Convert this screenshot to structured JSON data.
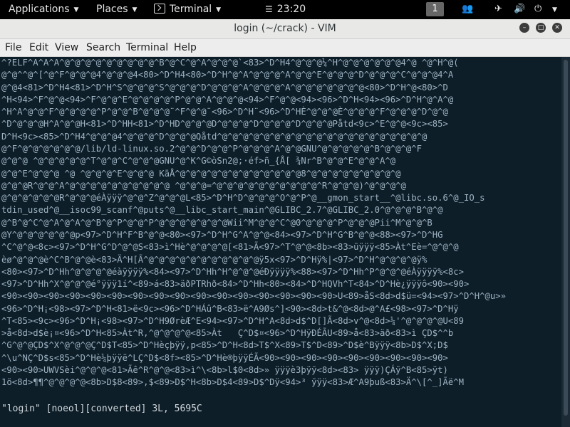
{
  "topbar": {
    "applications": "Applications",
    "places": "Places",
    "terminal": "Terminal",
    "clock": "23:20",
    "workspace": "1"
  },
  "window": {
    "title": "login (~/crack) - VIM"
  },
  "menu": [
    "File",
    "Edit",
    "View",
    "Search",
    "Terminal",
    "Help"
  ],
  "terminal": {
    "lines": [
      "^?ELF^A^A^A^@^@^@^@^@^@^@^@^@^B^@^C^@^A^@^@^@`<83>^D^H4^@^@^@¼^H^@^@^@^@^@^@4^@ ^@^H^@(",
      "@^@^^@^[^@^F^@^@^@4^@^@^@4<80>^D^H4<80>^D^H^@^A^@^@^@^A^@^@^E^@^@^@^D^@^@^@^C^@^@^@4^A",
      "@^@4<81>^D^H4<81>^D^H^S^@^@^@^S^@^@^@^D^@^@^@^A^@^@^@^A^@^@^@^@^@^@^@<80>^D^H^@<80>^D",
      "^H<94>^F^@^@<94>^F^@^@^E^@^@^@^@^P^@^@^A^@^@^@<94>^F^@^@<94><96>^D^H<94><96>^D^H^@^A^@",
      "^H^A^@^@^F^@^@^@^@^P^@^@^B^@^@^@¨^F^@^@¨<96>^D^H¨<96>^D^HÈ^@^@^@È^@^@^@^F^@^@^@^D^@^@",
      "^D^@^@^@H^A^@^@H<81>^D^HH<81>^D^HD^@^@^@D^@^@^@^D^@^@^@^D^@^@^@Påtd<9c>^E^@^@<9c><85>",
      "D^H<9c><85>^D^H4^@^@^@4^@^@^@^D^@^@^@Qåtd^@^@^@^@^@^@^@^@^@^@^@^@^@^@^@^@^@^@^@^@",
      "@^F^@^@^@^@^@^@/lib/ld-linux.so.2^@^@^D^@^@^P^@^@^@^A^@^@GNU^@^@^@^@^@^B^@^@^@^F",
      "@^@^@ ^@^@^@^@^@^T^@^@^C^@^@^@GNU^@^K^G©òSn2@;·éf>ñ_{Å[ ¾Nr^B^@^@^E^@^@^A^@",
      "@^@^E^@^@^@ ^@ ^@^@^@^E^@^@^@ KäÅ^@^@^@^@^@^@^@^@^@^@^@^@8^@^@^@^@^@^@^@^@^@",
      "@^@^@R^@^@^A^@^@^@^@^@^@^@^@^@^@ ^@^@^@=^@^@^@^@^@^@^@^@^@^@^R^@^@^@)^@^@^@^@",
      "@^@^@^@^@^@R^@^@^@éÀÿÿÿ^@^@^Z^@^@^@L<85>^D^H^D^@^@^@^O^@^P^@__gmon_start__^@libc.so.6^@_IO_s",
      "tdin_used^@__isoc99_scanf^@puts^@__libc_start_main^@GLIBC_2.7^@GLIBC_2.0^@^@^@^B^@^@",
      "@^B^@^C^@^A^@^A^@^B^@^P^@^@^P^@^@^@^@^@^@^@Wii^M^@^@^C^@0^@^@^@^P^@^@^@Pii^M^@^@^B",
      "@Y^@^@^@^@^@^@p<97>^D^H^F^B^@^@<80><97>^D^H^G^A^@^@<84><97>^D^H^G^B^@^@<88><97>^D^HG",
      "^C^@^@<8c><97>^D^H^G^D^@^@S<83>ì^Hè^@^@^@^@[<81>Ã<97>^T^@^@<8b><83>üÿÿÿ<85>Àt^Eè=^@^@^@",
      "èø^@^@^@è^C^B^@^@è<83>Ä^H[Ã^@^@^@^@^@^@^@^@^@^@^@ÿ5x<97>^D^Hÿ%|<97>^D^H^@^@^@^@ÿ%",
      "<80><97>^D^Hh^@^@^@^@éàÿÿÿÿ%<84><97>^D^Hh^H^@^@^@éÐÿÿÿÿ%<88><97>^D^Hh^P^@^@^@éÀÿÿÿÿ%<8c>",
      "<97>^D^Hh^X^@^@^@é°ÿÿÿ1í^<89>á<83>äðPTRhð<84>^D^Hh<80><84>^D^HQVh^T<84>^D^Hè¿ÿÿÿô<90><90>",
      "<90><90><90><90><90><90><90><90><90><90><90><90><90><90><90><90>U<89>åS<8d>d$ü=<94><97>^D^H^@u>»",
      "<96>^D^H¡<98><97>^D^H<81>ë<9c><96>^D^HÁû^B<83>ë^A9Øs^]<90><8d>t&^@<8d>@^A£<98><97>^D^Hÿ",
      "^T<85><9c><96>^D^H¡<98><97>^D^H9ØrèÆ^E<94><97>^D^H^A<8d>d$^D[]Ã<8d>v^@<8d>¼'^@^@^@^@U<89",
      ">å<8d>d$è¡¤<96>^D^H<85>Àt^R,^@^@^@^@<85>Àt   Ç^D$¤<96>^D^HÿÐÉÃU<89>å<83>äð<83>ì ÇD$^^b",
      "^G^@^@ÇD$^X^@^@^@Ç^D$T<85>^D^Hèçþÿÿ,p<85>^D^H<8d>T$^X<89>T$^D<89>^D$è^Bÿÿÿ<8b>D$^X;D$",
      "^\\u^NÇ^D$s<85>^D^Hè¼þÿÿë^LÇ^D$<8f><85>^D^Hè®þÿÿÉÃ<90><90><90><90><90><90><90><90><90>",
      "<90><90>UWVSèi^@^@^@<81>Ãê^R^@^@<83>ì^\\<8b>l$0<8d>» ÿÿÿè3þÿÿ<8d><83> ÿÿÿ)ÇÁÿ^B<85>ÿt)",
      "1ö<8d>¶¶^@^@^@^@<8b>D$8<89>,$<89>D$^H<8b>D$4<89>D$^Dÿ<94>³ ÿÿÿ<83>Æ^A9þuß<83>Ä^\\[^_]Ãë^M"
    ],
    "status": "\"login\" [noeol][converted] 3L, 5695C"
  }
}
